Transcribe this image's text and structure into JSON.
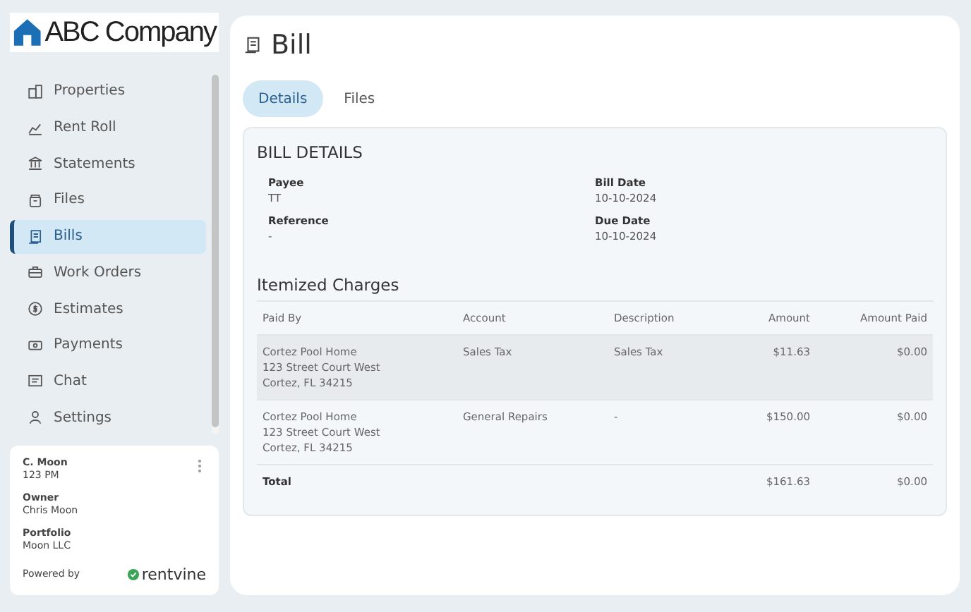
{
  "logo": {
    "text": "ABC Company"
  },
  "nav": [
    {
      "label": "Properties",
      "selected": false
    },
    {
      "label": "Rent Roll",
      "selected": false
    },
    {
      "label": "Statements",
      "selected": false
    },
    {
      "label": "Files",
      "selected": false
    },
    {
      "label": "Bills",
      "selected": true
    },
    {
      "label": "Work Orders",
      "selected": false
    },
    {
      "label": "Estimates",
      "selected": false
    },
    {
      "label": "Payments",
      "selected": false
    },
    {
      "label": "Chat",
      "selected": false
    },
    {
      "label": "Settings",
      "selected": false
    }
  ],
  "account": {
    "name": "C. Moon",
    "unit": "123 PM",
    "fields": [
      {
        "label": "Owner",
        "value": "Chris Moon"
      },
      {
        "label": "Portfolio",
        "value": "Moon LLC"
      }
    ],
    "powered_by": "Powered by",
    "brand": "rentvine"
  },
  "page": {
    "title": "Bill"
  },
  "tabs": [
    {
      "label": "Details",
      "selected": true
    },
    {
      "label": "Files",
      "selected": false
    }
  ],
  "details": {
    "heading": "BILL DETAILS",
    "fields": [
      {
        "label": "Payee",
        "value": "TT"
      },
      {
        "label": "Bill Date",
        "value": "10-10-2024"
      },
      {
        "label": "Reference",
        "value": "-"
      },
      {
        "label": "Due Date",
        "value": "10-10-2024"
      }
    ]
  },
  "charges": {
    "heading": "Itemized Charges",
    "columns": [
      "Paid By",
      "Account",
      "Description",
      "Amount",
      "Amount Paid"
    ],
    "rows": [
      {
        "paid_by": [
          "Cortez Pool Home",
          "123 Street Court West",
          "Cortez, FL 34215"
        ],
        "account": "Sales Tax",
        "description": "Sales Tax",
        "amount": "$11.63",
        "amount_paid": "$0.00",
        "highlighted": true
      },
      {
        "paid_by": [
          "Cortez Pool Home",
          "123 Street Court West",
          "Cortez, FL 34215"
        ],
        "account": "General Repairs",
        "description": "-",
        "amount": "$150.00",
        "amount_paid": "$0.00",
        "highlighted": false
      }
    ],
    "total": {
      "label": "Total",
      "amount": "$161.63",
      "amount_paid": "$0.00"
    }
  }
}
